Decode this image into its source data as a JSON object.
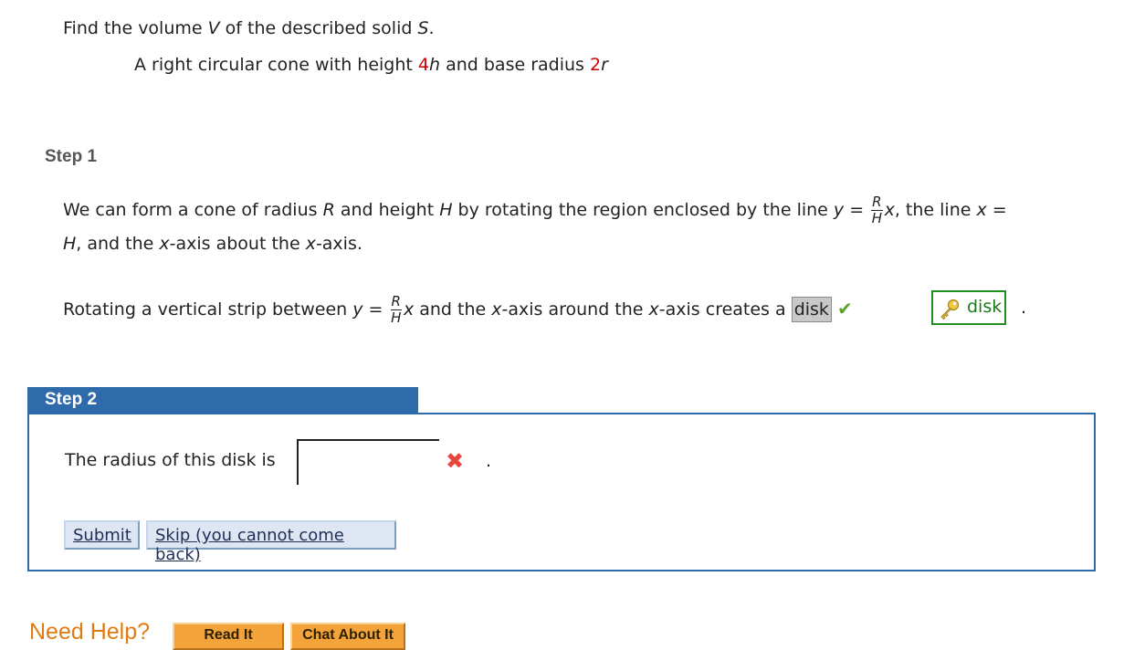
{
  "question": {
    "prompt_pre": "Find the volume ",
    "prompt_var1": "V",
    "prompt_mid": " of the described solid ",
    "prompt_var2": "S",
    "prompt_end": ".",
    "desc_pre": "A right circular cone with height ",
    "height_coef": "4",
    "height_var": "h",
    "desc_mid": " and base radius ",
    "radius_coef": "2",
    "radius_var": "r"
  },
  "step1": {
    "label": "Step 1",
    "line1_pre": "We can form a cone of radius ",
    "var_R": "R",
    "line1_mid": " and height ",
    "var_H": "H",
    "line1_mid2": " by rotating the region enclosed by the line ",
    "var_y": "y",
    "equals": " = ",
    "frac_num": "R",
    "frac_den": "H",
    "var_x": "x",
    "line1_end": ", the line ",
    "var_x2": "x",
    "equals2": " =",
    "line2_var": "H",
    "line2_mid": ", and the ",
    "line2_x1": "x",
    "line2_mid2": "-axis about the ",
    "line2_x2": "x",
    "line2_end": "-axis.",
    "rot_pre": "Rotating a vertical strip between ",
    "rot_y": "y",
    "rot_eq": " = ",
    "rot_num": "R",
    "rot_den": "H",
    "rot_x": "x",
    "rot_mid": " and the ",
    "rot_x2": "x",
    "rot_mid2": "-axis around the ",
    "rot_x3": "x",
    "rot_end": "-axis creates a ",
    "answer": "disk",
    "key_answer": "disk",
    "period": "."
  },
  "step2": {
    "label": "Step 2",
    "radius_prompt": "The radius of this disk is",
    "radius_value": "",
    "period": ".",
    "submit_label": "Submit",
    "skip_label": "Skip (you cannot come back)"
  },
  "help": {
    "title": "Need Help?",
    "read_it": "Read It",
    "chat_about_it": "Chat About It"
  },
  "colors": {
    "accent_blue": "#2f6aab",
    "correct_green": "#1f8f1f",
    "wrong_red": "#e8463c",
    "highlight_red": "#d40000",
    "help_orange": "#e07b12"
  }
}
